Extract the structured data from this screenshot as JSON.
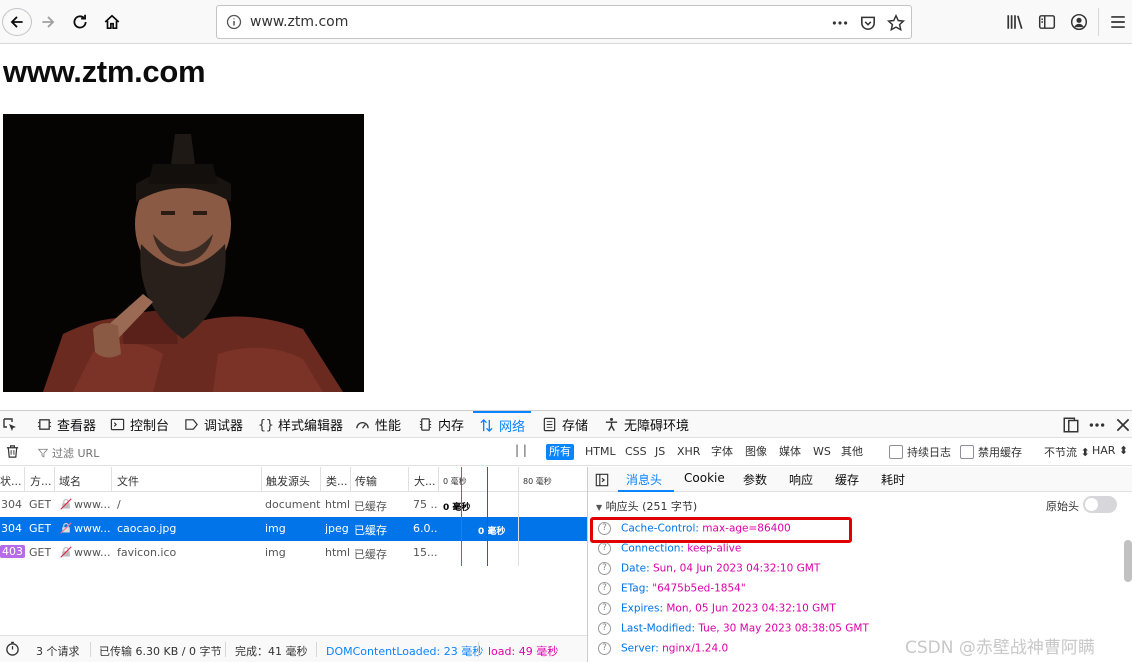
{
  "browser": {
    "url": "www.ztm.com"
  },
  "page": {
    "heading": "www.ztm.com"
  },
  "devtools": {
    "tabs": [
      {
        "label": "查看器"
      },
      {
        "label": "控制台"
      },
      {
        "label": "调试器"
      },
      {
        "label": "样式编辑器"
      },
      {
        "label": "性能"
      },
      {
        "label": "内存"
      },
      {
        "label": "网络"
      },
      {
        "label": "存储"
      },
      {
        "label": "无障碍环境"
      }
    ],
    "filter": {
      "placeholder": "过滤 URL",
      "pause": "| |",
      "types": [
        "所有",
        "HTML",
        "CSS",
        "JS",
        "XHR",
        "字体",
        "图像",
        "媒体",
        "WS",
        "其他"
      ],
      "persist_log": "持续日志",
      "disable_cache": "禁用缓存",
      "throttle": "不节流 ⬍",
      "har": "HAR ⬍"
    },
    "columns": {
      "status": "状...",
      "method": "方...",
      "domain": "域名",
      "file": "文件",
      "cause": "触发源头",
      "type": "类...",
      "transferred": "传输",
      "size": "大...",
      "timing0": "0 毫秒",
      "timing80": "80 毫秒"
    },
    "requests": [
      {
        "status": "304",
        "method": "GET",
        "domain": "www....",
        "file": "/",
        "cause": "document",
        "type": "html",
        "transferred": "已缓存",
        "size": "75 ...",
        "timing": "0 毫秒"
      },
      {
        "status": "304",
        "method": "GET",
        "domain": "www....",
        "file": "caocao.jpg",
        "cause": "img",
        "type": "jpeg",
        "transferred": "已缓存",
        "size": "6.0...",
        "timing": "0 毫秒"
      },
      {
        "status": "403",
        "method": "GET",
        "domain": "www....",
        "file": "favicon.ico",
        "cause": "img",
        "type": "html",
        "transferred": "已缓存",
        "size": "15...",
        "timing": ""
      }
    ],
    "footer": {
      "requests": "3 个请求",
      "transferred": "已传输 6.30 KB / 0 字节",
      "finish": "完成：41 毫秒",
      "dcl": "DOMContentLoaded: 23 毫秒",
      "load": "load: 49 毫秒"
    },
    "side": {
      "tabs": [
        "消息头",
        "Cookie",
        "参数",
        "响应",
        "缓存",
        "耗时"
      ],
      "response_title": "响应头 (251 字节)",
      "raw_label": "原始头",
      "headers": [
        {
          "k": "Cache-Control:",
          "v": "max-age=86400"
        },
        {
          "k": "Connection:",
          "v": "keep-alive"
        },
        {
          "k": "Date:",
          "v": "Sun, 04 Jun 2023 04:32:10 GMT"
        },
        {
          "k": "ETag:",
          "v": "\"6475b5ed-1854\""
        },
        {
          "k": "Expires:",
          "v": "Mon, 05 Jun 2023 04:32:10 GMT"
        },
        {
          "k": "Last-Modified:",
          "v": "Tue, 30 May 2023 08:38:05 GMT"
        },
        {
          "k": "Server:",
          "v": "nginx/1.24.0"
        }
      ]
    }
  },
  "watermark": "CSDN @赤壁战神曹阿瞒",
  "colors": {
    "accent": "#0a84ff",
    "selected_row": "#0074e8",
    "header_value": "#dd00a9",
    "highlight_box": "#e00000"
  }
}
